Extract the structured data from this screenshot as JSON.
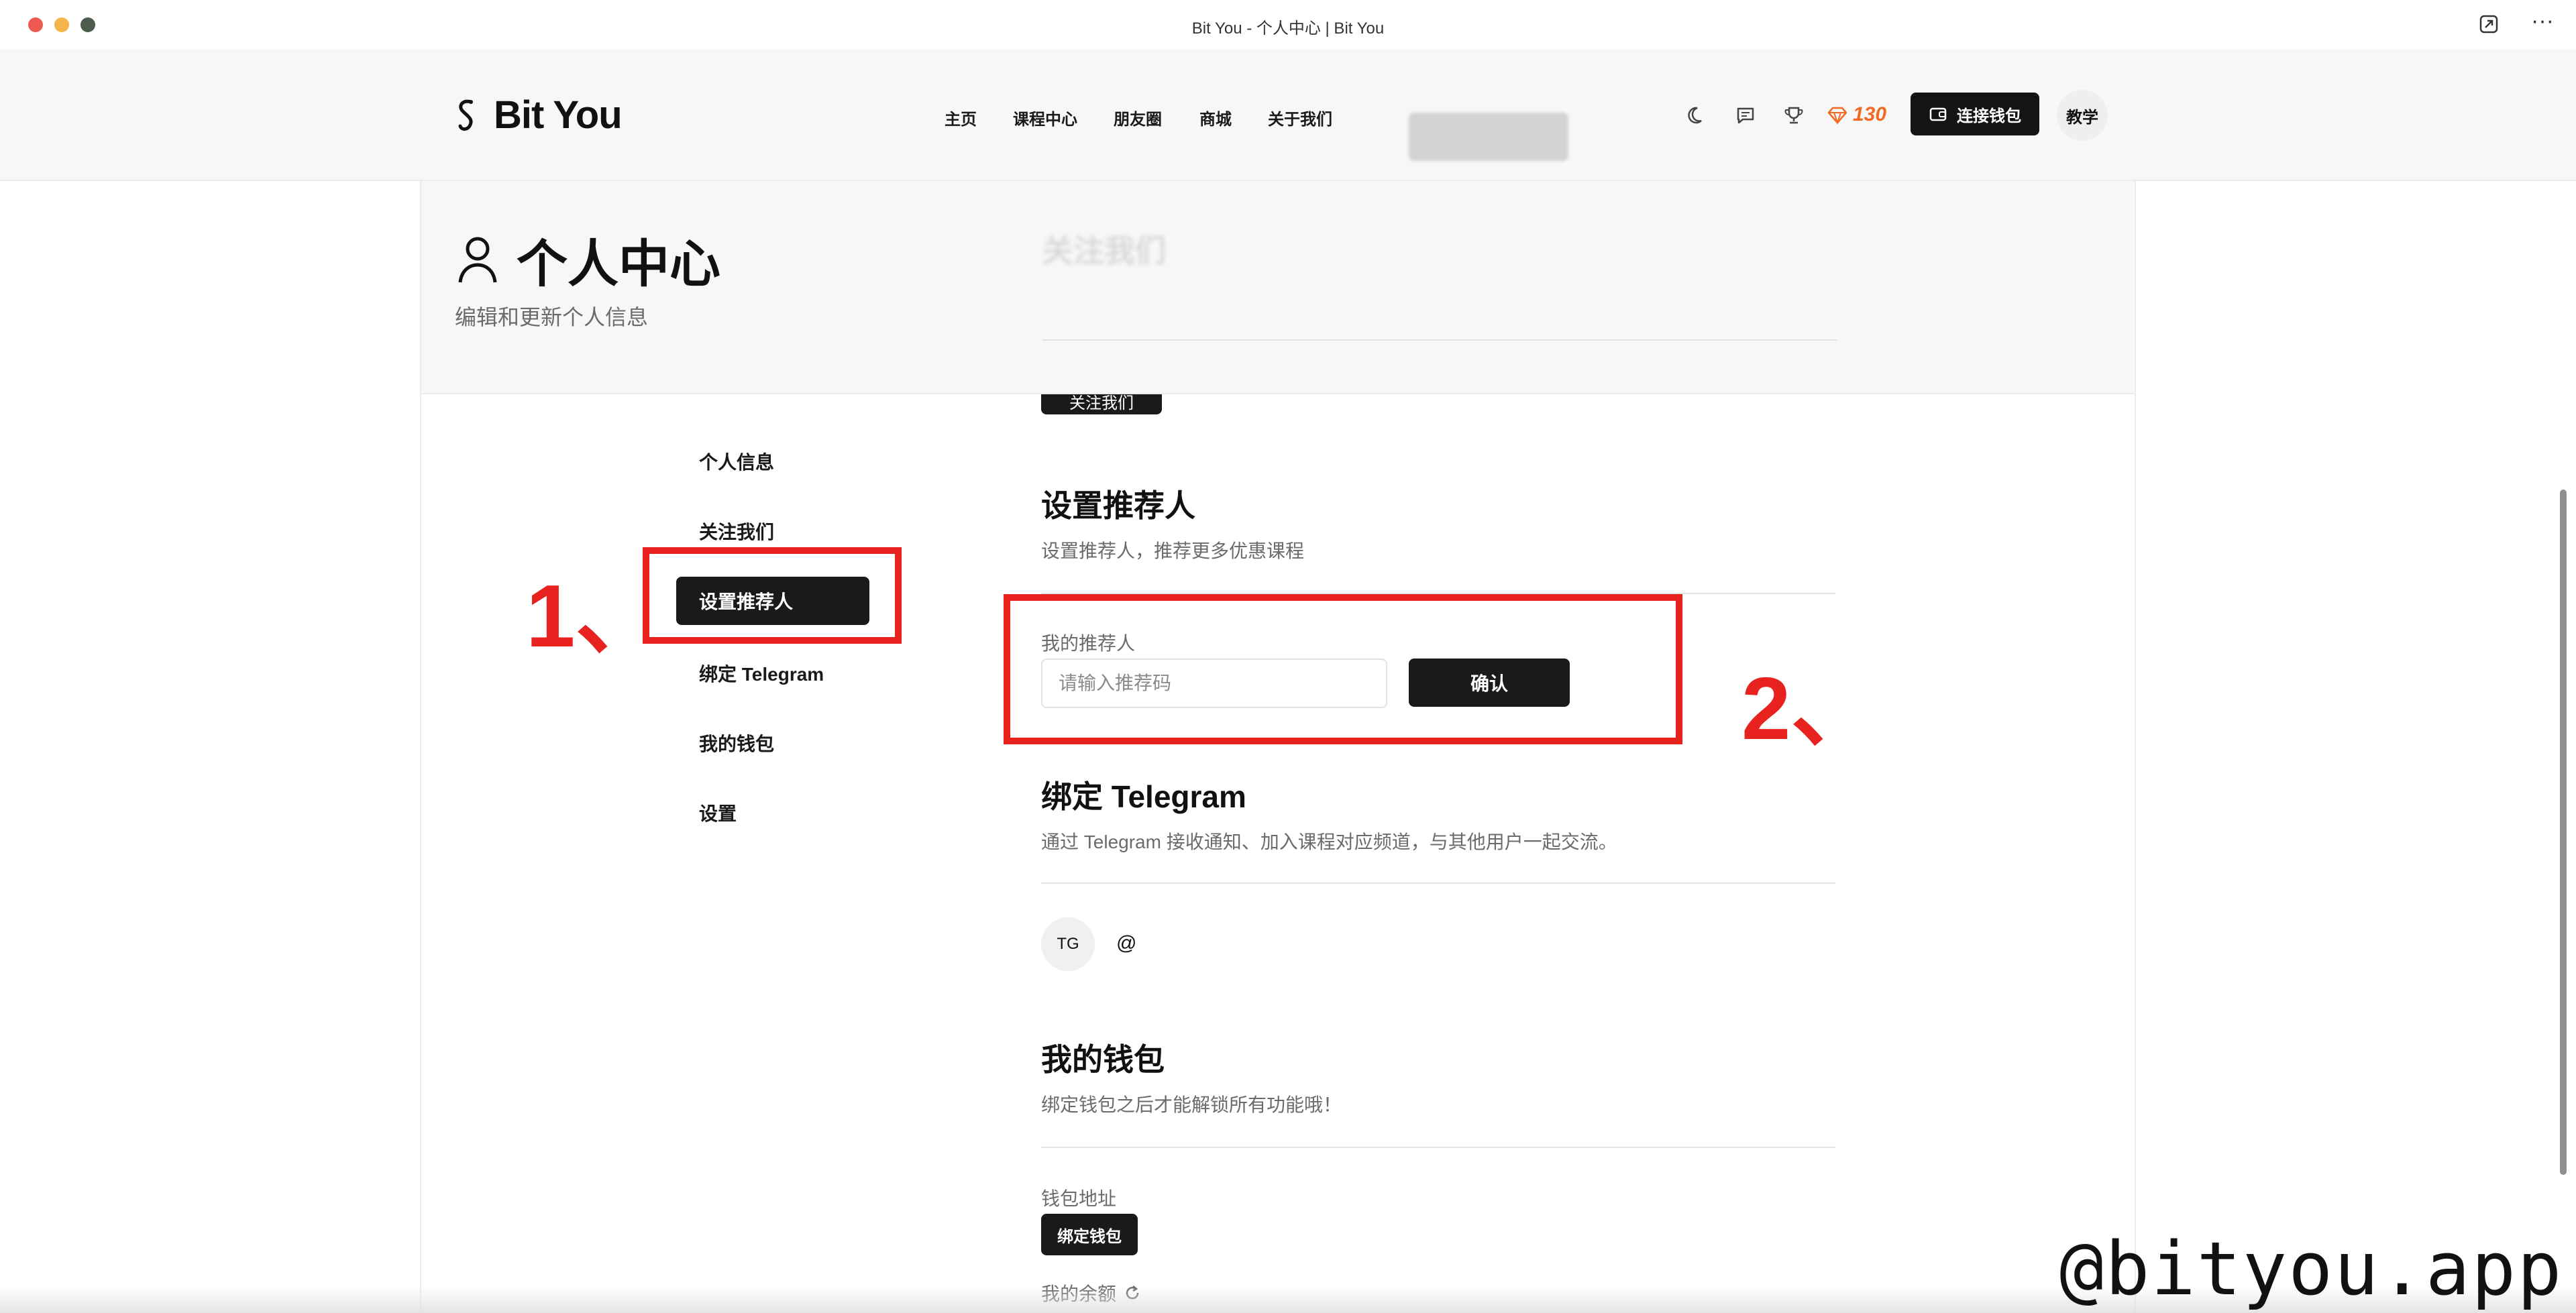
{
  "window": {
    "title": "Bit You - 个人中心 | Bit You"
  },
  "brand": {
    "name": "Bit You"
  },
  "nav": {
    "items": [
      "主页",
      "课程中心",
      "朋友圈",
      "商城",
      "关于我们"
    ]
  },
  "header": {
    "points": "130",
    "connect_wallet": "连接钱包",
    "teach": "教学"
  },
  "hero": {
    "title": "个人中心",
    "subtitle": "编辑和更新个人信息"
  },
  "sidebar": {
    "items": [
      "个人信息",
      "关注我们",
      "设置推荐人",
      "绑定 Telegram",
      "我的钱包",
      "设置"
    ],
    "active_index": 2
  },
  "follow": {
    "x_button": "关注我们"
  },
  "referral": {
    "title": "设置推荐人",
    "description": "设置推荐人，推荐更多优惠课程",
    "label": "我的推荐人",
    "placeholder": "请输入推荐码",
    "confirm": "确认"
  },
  "telegram": {
    "title": "绑定 Telegram",
    "description": "通过 Telegram 接收通知、加入课程对应频道，与其他用户一起交流。",
    "avatar": "TG",
    "handle": "@"
  },
  "wallet": {
    "title": "我的钱包",
    "description": "绑定钱包之后才能解锁所有功能哦！",
    "address_label": "钱包地址",
    "bind_button": "绑定钱包",
    "balance_label": "我的余额"
  },
  "annotations": {
    "step1": "1、",
    "step2": "2、",
    "color": "#e8231f"
  },
  "watermark": "@bityou.app",
  "colors": {
    "accent": "#f26a21",
    "dark": "#1a1a1a"
  }
}
